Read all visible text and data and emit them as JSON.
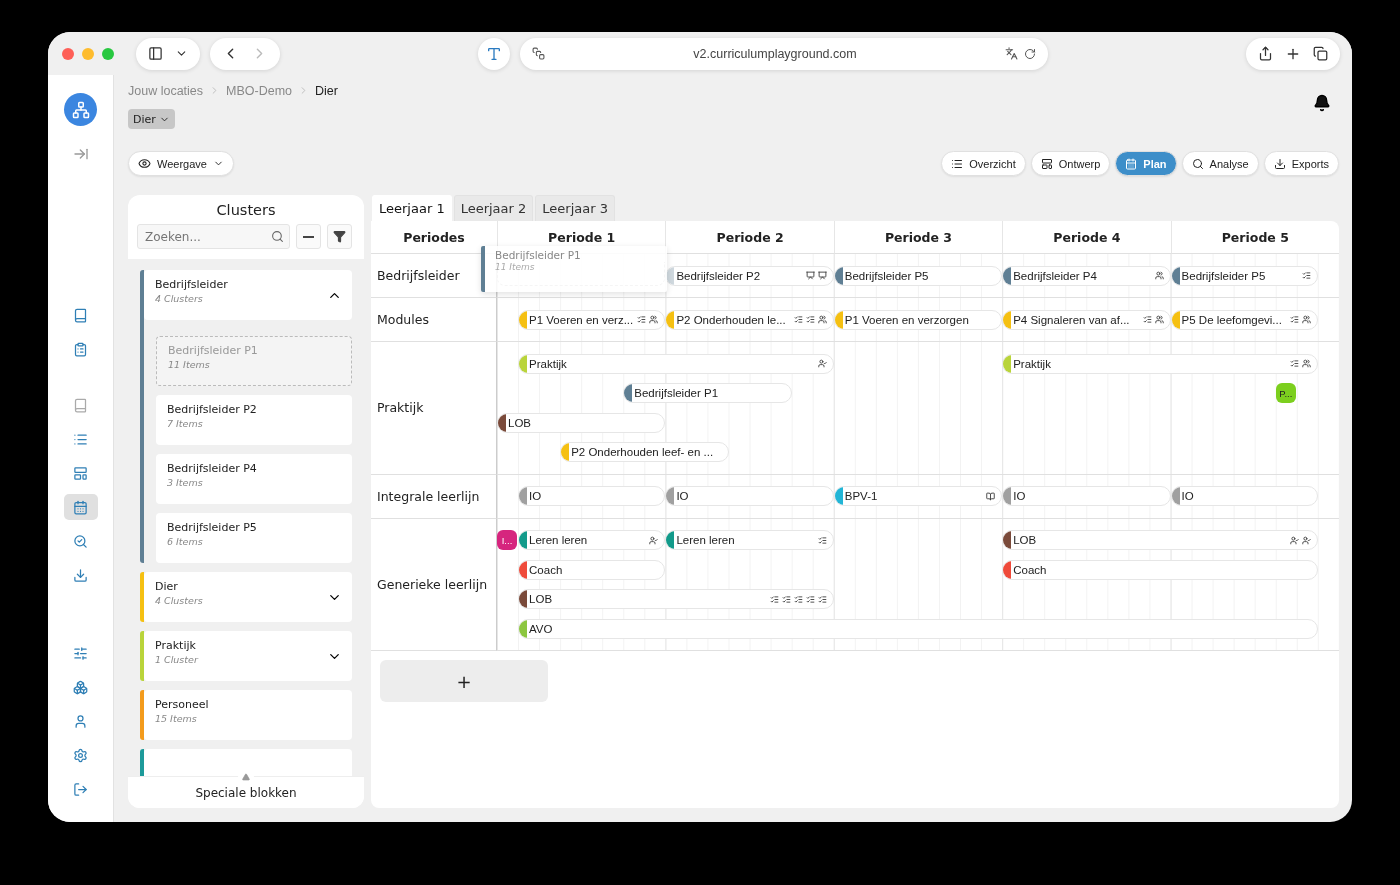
{
  "browser": {
    "url": "v2.curriculumplayground.com"
  },
  "rail": {
    "groups": [
      [
        {
          "selected": false,
          "disabled": false
        },
        {
          "selected": false,
          "disabled": false
        },
        {
          "selected": false,
          "disabled": true
        },
        {
          "selected": false,
          "disabled": false
        },
        {
          "selected": false,
          "disabled": false
        },
        {
          "selected": true,
          "disabled": false
        },
        {
          "selected": false,
          "disabled": false
        },
        {
          "selected": false,
          "disabled": false
        }
      ],
      [
        {
          "selected": false,
          "disabled": false
        },
        {
          "selected": false,
          "disabled": false
        },
        {
          "selected": false,
          "disabled": false
        },
        {
          "selected": false,
          "disabled": false
        },
        {
          "selected": false,
          "disabled": false
        }
      ]
    ]
  },
  "breadcrumb": [
    "Jouw locaties",
    "MBO-Demo",
    "Dier"
  ],
  "location_dropdown": "Dier",
  "view_button": "Weergave",
  "nav_buttons": [
    {
      "label": "Overzicht",
      "selected": false
    },
    {
      "label": "Ontwerp",
      "selected": false
    },
    {
      "label": "Plan",
      "selected": true
    },
    {
      "label": "Analyse",
      "selected": false
    },
    {
      "label": "Exports",
      "selected": false
    }
  ],
  "clusters": {
    "title": "Clusters",
    "search": {
      "placeholder": "Zoeken..."
    },
    "groups": [
      {
        "title": "Bedrijfsleider",
        "count": "4 Clusters",
        "color": "#5f7f94",
        "expanded": true,
        "children": [
          {
            "title": "Bedrijfsleider P1",
            "count": "11 Items",
            "dragging": true
          },
          {
            "title": "Bedrijfsleider P2",
            "count": "7 Items",
            "dragging": false
          },
          {
            "title": "Bedrijfsleider P4",
            "count": "3 Items",
            "dragging": false
          },
          {
            "title": "Bedrijfsleider P5",
            "count": "6 Items",
            "dragging": false
          }
        ]
      },
      {
        "title": "Dier",
        "count": "4 Clusters",
        "color": "#f5c012",
        "expanded": false
      },
      {
        "title": "Praktijk",
        "count": "1 Cluster",
        "color": "#b9d43a",
        "expanded": false
      },
      {
        "title": "Personeel",
        "count": "15 Items",
        "color": "#f39b1c"
      },
      {
        "color": "#1d9a9a"
      }
    ],
    "footer": "Speciale blokken"
  },
  "year_tabs": [
    {
      "label": "Leerjaar 1",
      "selected": true
    },
    {
      "label": "Leerjaar 2",
      "selected": false
    },
    {
      "label": "Leerjaar 3",
      "selected": false
    }
  ],
  "plan": {
    "columns": [
      "Periodes",
      "Periode 1",
      "Periode 2",
      "Periode 3",
      "Periode 4",
      "Periode 5"
    ],
    "rows": [
      {
        "label": "Bedrijfsleider",
        "lines": [
          [
            {
              "kind": "slot"
            },
            {
              "kind": "bar",
              "text": "Bedrijfsleider P2",
              "color": "#cfd8de"
            },
            {
              "kind": "bar",
              "text": "Bedrijfsleider P5",
              "color": "#5f7f94"
            },
            {
              "kind": "bar",
              "text": "Bedrijfsleider P4",
              "color": "#5f7f94"
            },
            {
              "kind": "bar",
              "text": "Bedrijfsleider P5",
              "color": "#5f7f94"
            }
          ]
        ]
      },
      {
        "label": "Modules",
        "lines": [
          [
            {
              "kind": "bar",
              "text": "P1 Voeren en verz...",
              "color": "#f5c012"
            },
            {
              "kind": "bar",
              "text": "P2 Onderhouden le...",
              "color": "#f5c012"
            },
            {
              "kind": "bar",
              "text": "P1 Voeren en verzorgen",
              "color": "#f5c012"
            },
            {
              "kind": "bar",
              "text": "P4 Signaleren van af...",
              "color": "#f5c012"
            },
            {
              "kind": "bar",
              "text": "P5 De leefomgevi...",
              "color": "#f5c012"
            }
          ]
        ]
      },
      {
        "label": "Praktijk",
        "lines": [
          [
            {
              "kind": "bar",
              "text": "Praktijk",
              "color": "#b9d43a"
            },
            {
              "kind": "bar",
              "text": "Praktijk",
              "color": "#b9d43a"
            }
          ],
          [
            {
              "kind": "bar",
              "text": "Bedrijfsleider P1",
              "color": "#5f7f94"
            },
            {
              "kind": "badge",
              "text": "P...",
              "color": "#7ccf1e"
            }
          ],
          [
            {
              "kind": "bar",
              "text": "LOB",
              "color": "#7a4a3a"
            }
          ],
          [
            {
              "kind": "bar",
              "text": "P2 Onderhouden leef- en ...",
              "color": "#f5c012"
            }
          ]
        ]
      },
      {
        "label": "Integrale leerlijn",
        "lines": [
          [
            {
              "kind": "bar",
              "text": "IO",
              "color": "#a0a0a0"
            },
            {
              "kind": "bar",
              "text": "IO",
              "color": "#a0a0a0"
            },
            {
              "kind": "bar",
              "text": "BPV-1",
              "color": "#22b5d6"
            },
            {
              "kind": "bar",
              "text": "IO",
              "color": "#a0a0a0"
            },
            {
              "kind": "bar",
              "text": "IO",
              "color": "#a0a0a0"
            }
          ]
        ]
      },
      {
        "label": "Generieke leerlijn",
        "lines": [
          [
            {
              "kind": "badge",
              "text": "I...",
              "color": "#d6257e"
            },
            {
              "kind": "bar",
              "text": "Leren leren",
              "color": "#129a8a"
            },
            {
              "kind": "bar",
              "text": "Leren leren",
              "color": "#129a8a"
            },
            {
              "kind": "bar",
              "text": "LOB",
              "color": "#7a4a3a"
            }
          ],
          [
            {
              "kind": "bar",
              "text": "Coach",
              "color": "#ef4a3a"
            },
            {
              "kind": "bar",
              "text": "Coach",
              "color": "#ef4a3a"
            }
          ],
          [
            {
              "kind": "bar",
              "text": "LOB",
              "color": "#7a4a3a"
            }
          ],
          [
            {
              "kind": "bar",
              "text": "AVO",
              "color": "#8cc63f"
            }
          ]
        ]
      }
    ],
    "drag_ghost": {
      "title": "Bedrijfsleider P1",
      "count": "11 Items"
    },
    "add_button": "+"
  }
}
